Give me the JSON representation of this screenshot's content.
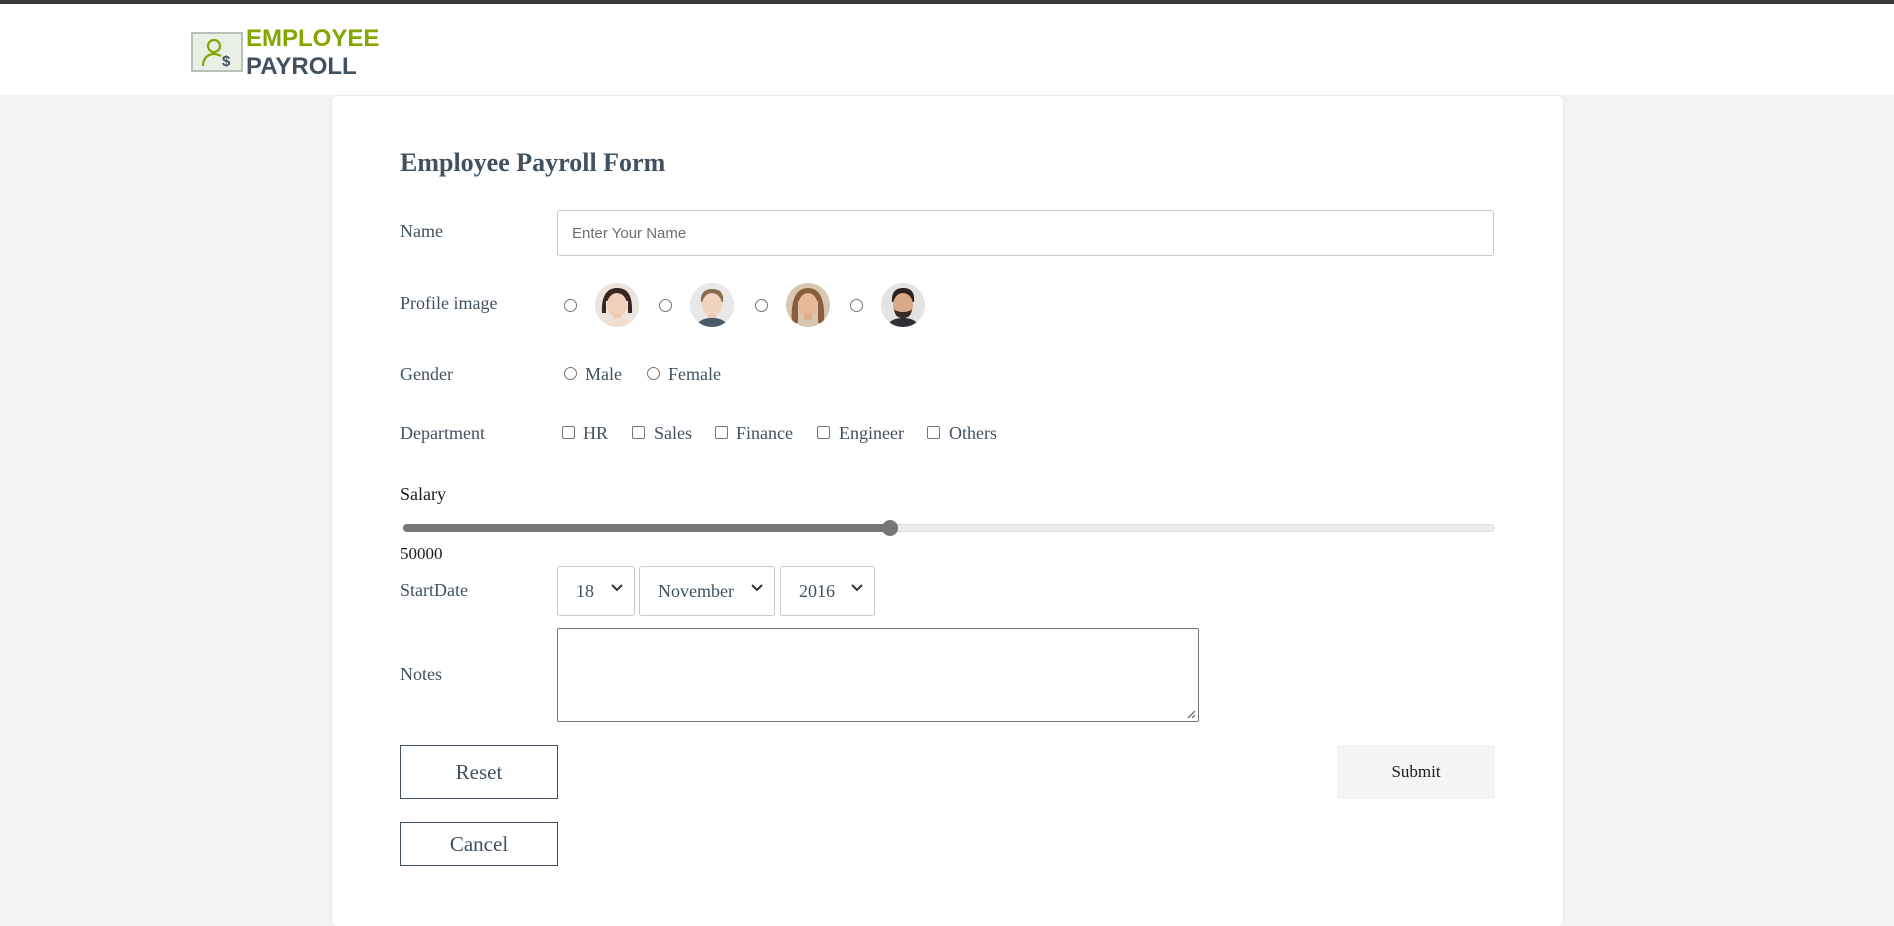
{
  "app": {
    "logo_line1": "EMPLOYEE",
    "logo_line2": "PAYROLL",
    "accent_color": "#82a700",
    "text_color": "#42515f"
  },
  "form": {
    "title": "Employee Payroll Form",
    "name": {
      "label": "Name",
      "value": "",
      "placeholder": "Enter Your Name"
    },
    "profile_image": {
      "label": "Profile image",
      "options": [
        "female-avatar-1",
        "male-avatar-1",
        "female-avatar-2",
        "male-avatar-2"
      ],
      "selected": null
    },
    "gender": {
      "label": "Gender",
      "options": [
        "Male",
        "Female"
      ],
      "selected": null
    },
    "department": {
      "label": "Department",
      "options": [
        "HR",
        "Sales",
        "Finance",
        "Engineer",
        "Others"
      ],
      "checked": []
    },
    "salary": {
      "label": "Salary",
      "value": "50000",
      "fraction": 0.446
    },
    "start_date": {
      "label": "StartDate",
      "day": "18",
      "month": "November",
      "year": "2016"
    },
    "notes": {
      "label": "Notes",
      "value": ""
    },
    "buttons": {
      "reset": "Reset",
      "submit": "Submit",
      "cancel": "Cancel"
    }
  }
}
